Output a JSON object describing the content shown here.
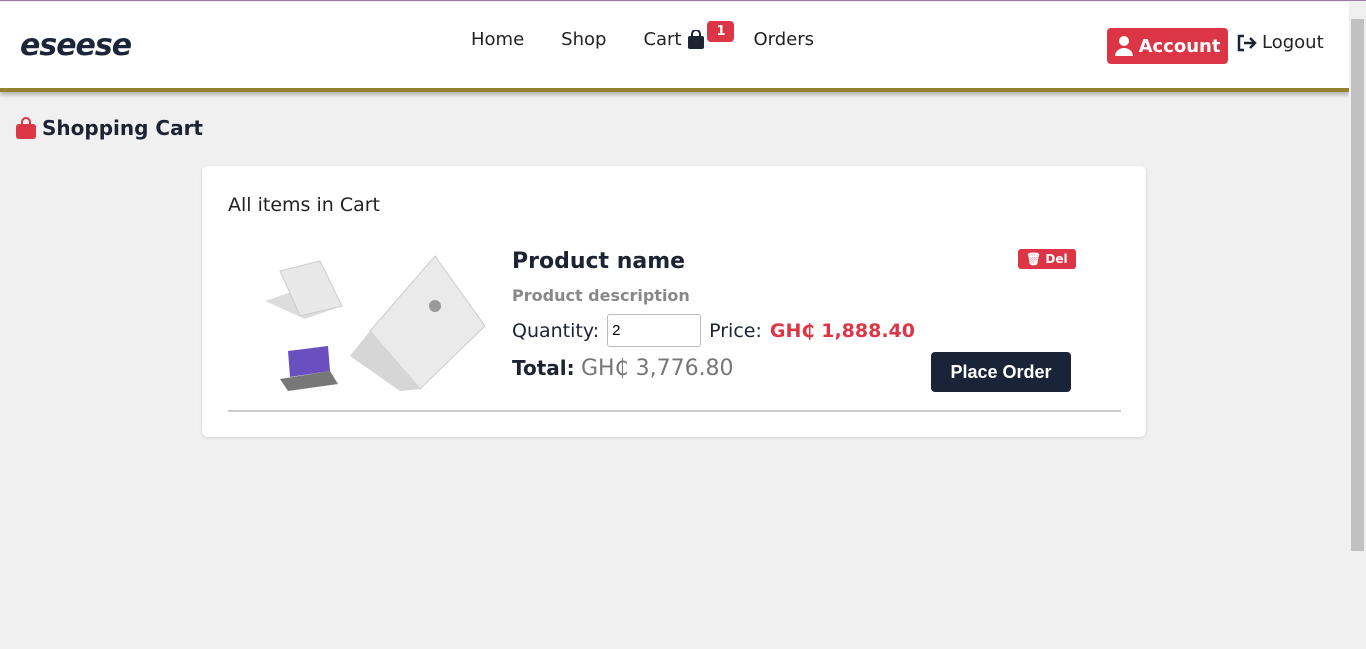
{
  "nav": {
    "logo": "eseese",
    "links": [
      "Home",
      "Shop",
      "Cart",
      "Orders"
    ],
    "cart_count": "1",
    "account": "Account",
    "logout": "Logout"
  },
  "page": {
    "title": "Shopping Cart"
  },
  "cart": {
    "heading": "All items in Cart",
    "item": {
      "name": "Product name",
      "description": "Product description",
      "quantity_label": "Quantity:",
      "quantity": "2",
      "price_label": "Price:",
      "price": "GH₵ 1,888.40",
      "total_label": "Total:",
      "total": "GH₵ 3,776.80",
      "delete": "Del",
      "place_order": "Place Order"
    }
  },
  "colors": {
    "accent": "#dc3545",
    "dark": "#1a2438"
  }
}
